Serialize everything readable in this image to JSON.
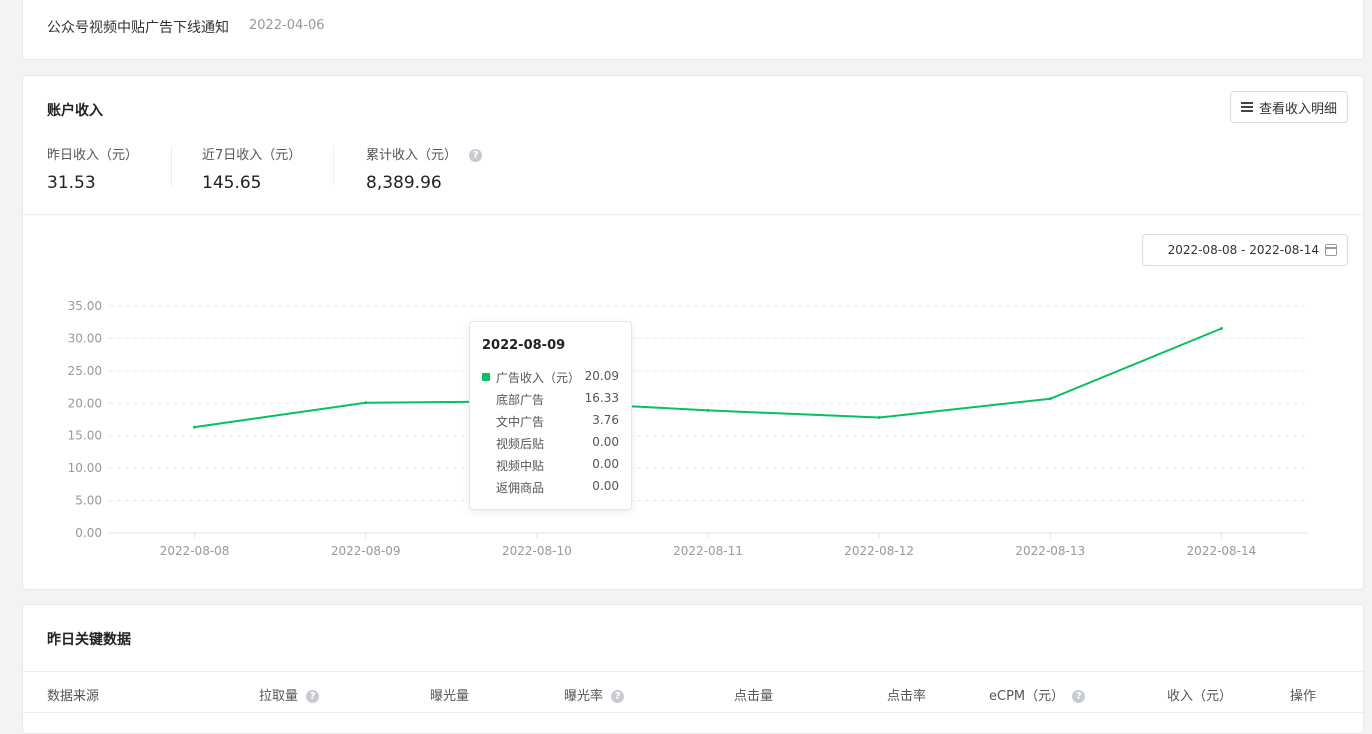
{
  "notice": {
    "title": "公众号视频中贴广告下线通知",
    "date": "2022-04-06"
  },
  "income": {
    "title": "账户收入",
    "detail_button": "查看收入明细",
    "stats": [
      {
        "label": "昨日收入（元）",
        "value": "31.53"
      },
      {
        "label": "近7日收入（元）",
        "value": "145.65"
      },
      {
        "label": "累计收入（元）",
        "value": "8,389.96"
      }
    ],
    "date_range": "2022-08-08 - 2022-08-14"
  },
  "chart_data": {
    "type": "line",
    "x": [
      "2022-08-08",
      "2022-08-09",
      "2022-08-10",
      "2022-08-11",
      "2022-08-12",
      "2022-08-13",
      "2022-08-14"
    ],
    "yticks": [
      "0.00",
      "5.00",
      "10.00",
      "15.00",
      "20.00",
      "25.00",
      "30.00",
      "35.00"
    ],
    "ylim": [
      0,
      35
    ],
    "series": [
      {
        "name": "广告收入（元）",
        "color": "#07c160",
        "values": [
          16.33,
          20.09,
          20.3,
          18.9,
          17.8,
          20.7,
          31.53
        ]
      }
    ],
    "grid": true
  },
  "tooltip": {
    "date": "2022-08-09",
    "rows": [
      {
        "label": "广告收入（元）",
        "value": "20.09"
      },
      {
        "label": "底部广告",
        "value": "16.33"
      },
      {
        "label": "文中广告",
        "value": "3.76"
      },
      {
        "label": "视频后贴",
        "value": "0.00"
      },
      {
        "label": "视频中贴",
        "value": "0.00"
      },
      {
        "label": "返佣商品",
        "value": "0.00"
      }
    ]
  },
  "keydata": {
    "title": "昨日关键数据",
    "columns": [
      "数据来源",
      "拉取量",
      "曝光量",
      "曝光率",
      "点击量",
      "点击率",
      "eCPM（元）",
      "收入（元）",
      "操作"
    ]
  }
}
